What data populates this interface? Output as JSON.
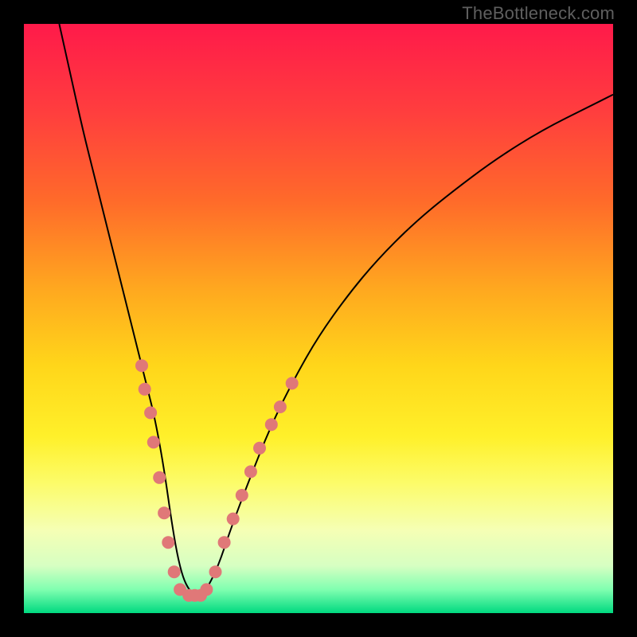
{
  "watermark": "TheBottleneck.com",
  "chart_data": {
    "type": "line",
    "title": "",
    "xlabel": "",
    "ylabel": "",
    "xlim": [
      0,
      100
    ],
    "ylim": [
      0,
      100
    ],
    "background_gradient": {
      "stops": [
        {
          "offset": 0.0,
          "color": "#ff1a4a"
        },
        {
          "offset": 0.15,
          "color": "#ff3e3e"
        },
        {
          "offset": 0.3,
          "color": "#ff6a2a"
        },
        {
          "offset": 0.45,
          "color": "#ffa81f"
        },
        {
          "offset": 0.58,
          "color": "#ffd61a"
        },
        {
          "offset": 0.7,
          "color": "#fff02a"
        },
        {
          "offset": 0.78,
          "color": "#fcfc6a"
        },
        {
          "offset": 0.86,
          "color": "#f5ffb5"
        },
        {
          "offset": 0.92,
          "color": "#d6ffc2"
        },
        {
          "offset": 0.96,
          "color": "#80ffb0"
        },
        {
          "offset": 1.0,
          "color": "#00d980"
        }
      ]
    },
    "series": [
      {
        "name": "bottleneck-curve",
        "color": "#000000",
        "stroke_width": 2,
        "x": [
          6,
          8,
          10,
          12,
          14,
          16,
          18,
          20,
          21,
          22,
          23,
          24,
          25,
          26,
          27,
          28,
          29,
          30,
          31,
          33,
          35,
          38,
          42,
          46,
          50,
          55,
          60,
          66,
          72,
          80,
          88,
          96,
          100
        ],
        "y": [
          100,
          91,
          82,
          74,
          66,
          58,
          50,
          42,
          38,
          34,
          29,
          23,
          16,
          10,
          6,
          4,
          3,
          3,
          4,
          8,
          14,
          22,
          32,
          40,
          47,
          54,
          60,
          66,
          71,
          77,
          82,
          86,
          88
        ]
      }
    ],
    "markers": {
      "name": "data-points",
      "color": "#e07878",
      "radius": 8,
      "points": [
        {
          "x": 20.0,
          "y": 42
        },
        {
          "x": 20.5,
          "y": 38
        },
        {
          "x": 21.5,
          "y": 34
        },
        {
          "x": 22.0,
          "y": 29
        },
        {
          "x": 23.0,
          "y": 23
        },
        {
          "x": 23.8,
          "y": 17
        },
        {
          "x": 24.5,
          "y": 12
        },
        {
          "x": 25.5,
          "y": 7
        },
        {
          "x": 26.5,
          "y": 4
        },
        {
          "x": 28.0,
          "y": 3
        },
        {
          "x": 29.0,
          "y": 3
        },
        {
          "x": 30.0,
          "y": 3
        },
        {
          "x": 31.0,
          "y": 4
        },
        {
          "x": 32.5,
          "y": 7
        },
        {
          "x": 34.0,
          "y": 12
        },
        {
          "x": 35.5,
          "y": 16
        },
        {
          "x": 37.0,
          "y": 20
        },
        {
          "x": 38.5,
          "y": 24
        },
        {
          "x": 40.0,
          "y": 28
        },
        {
          "x": 42.0,
          "y": 32
        },
        {
          "x": 43.5,
          "y": 35
        },
        {
          "x": 45.5,
          "y": 39
        }
      ]
    }
  }
}
